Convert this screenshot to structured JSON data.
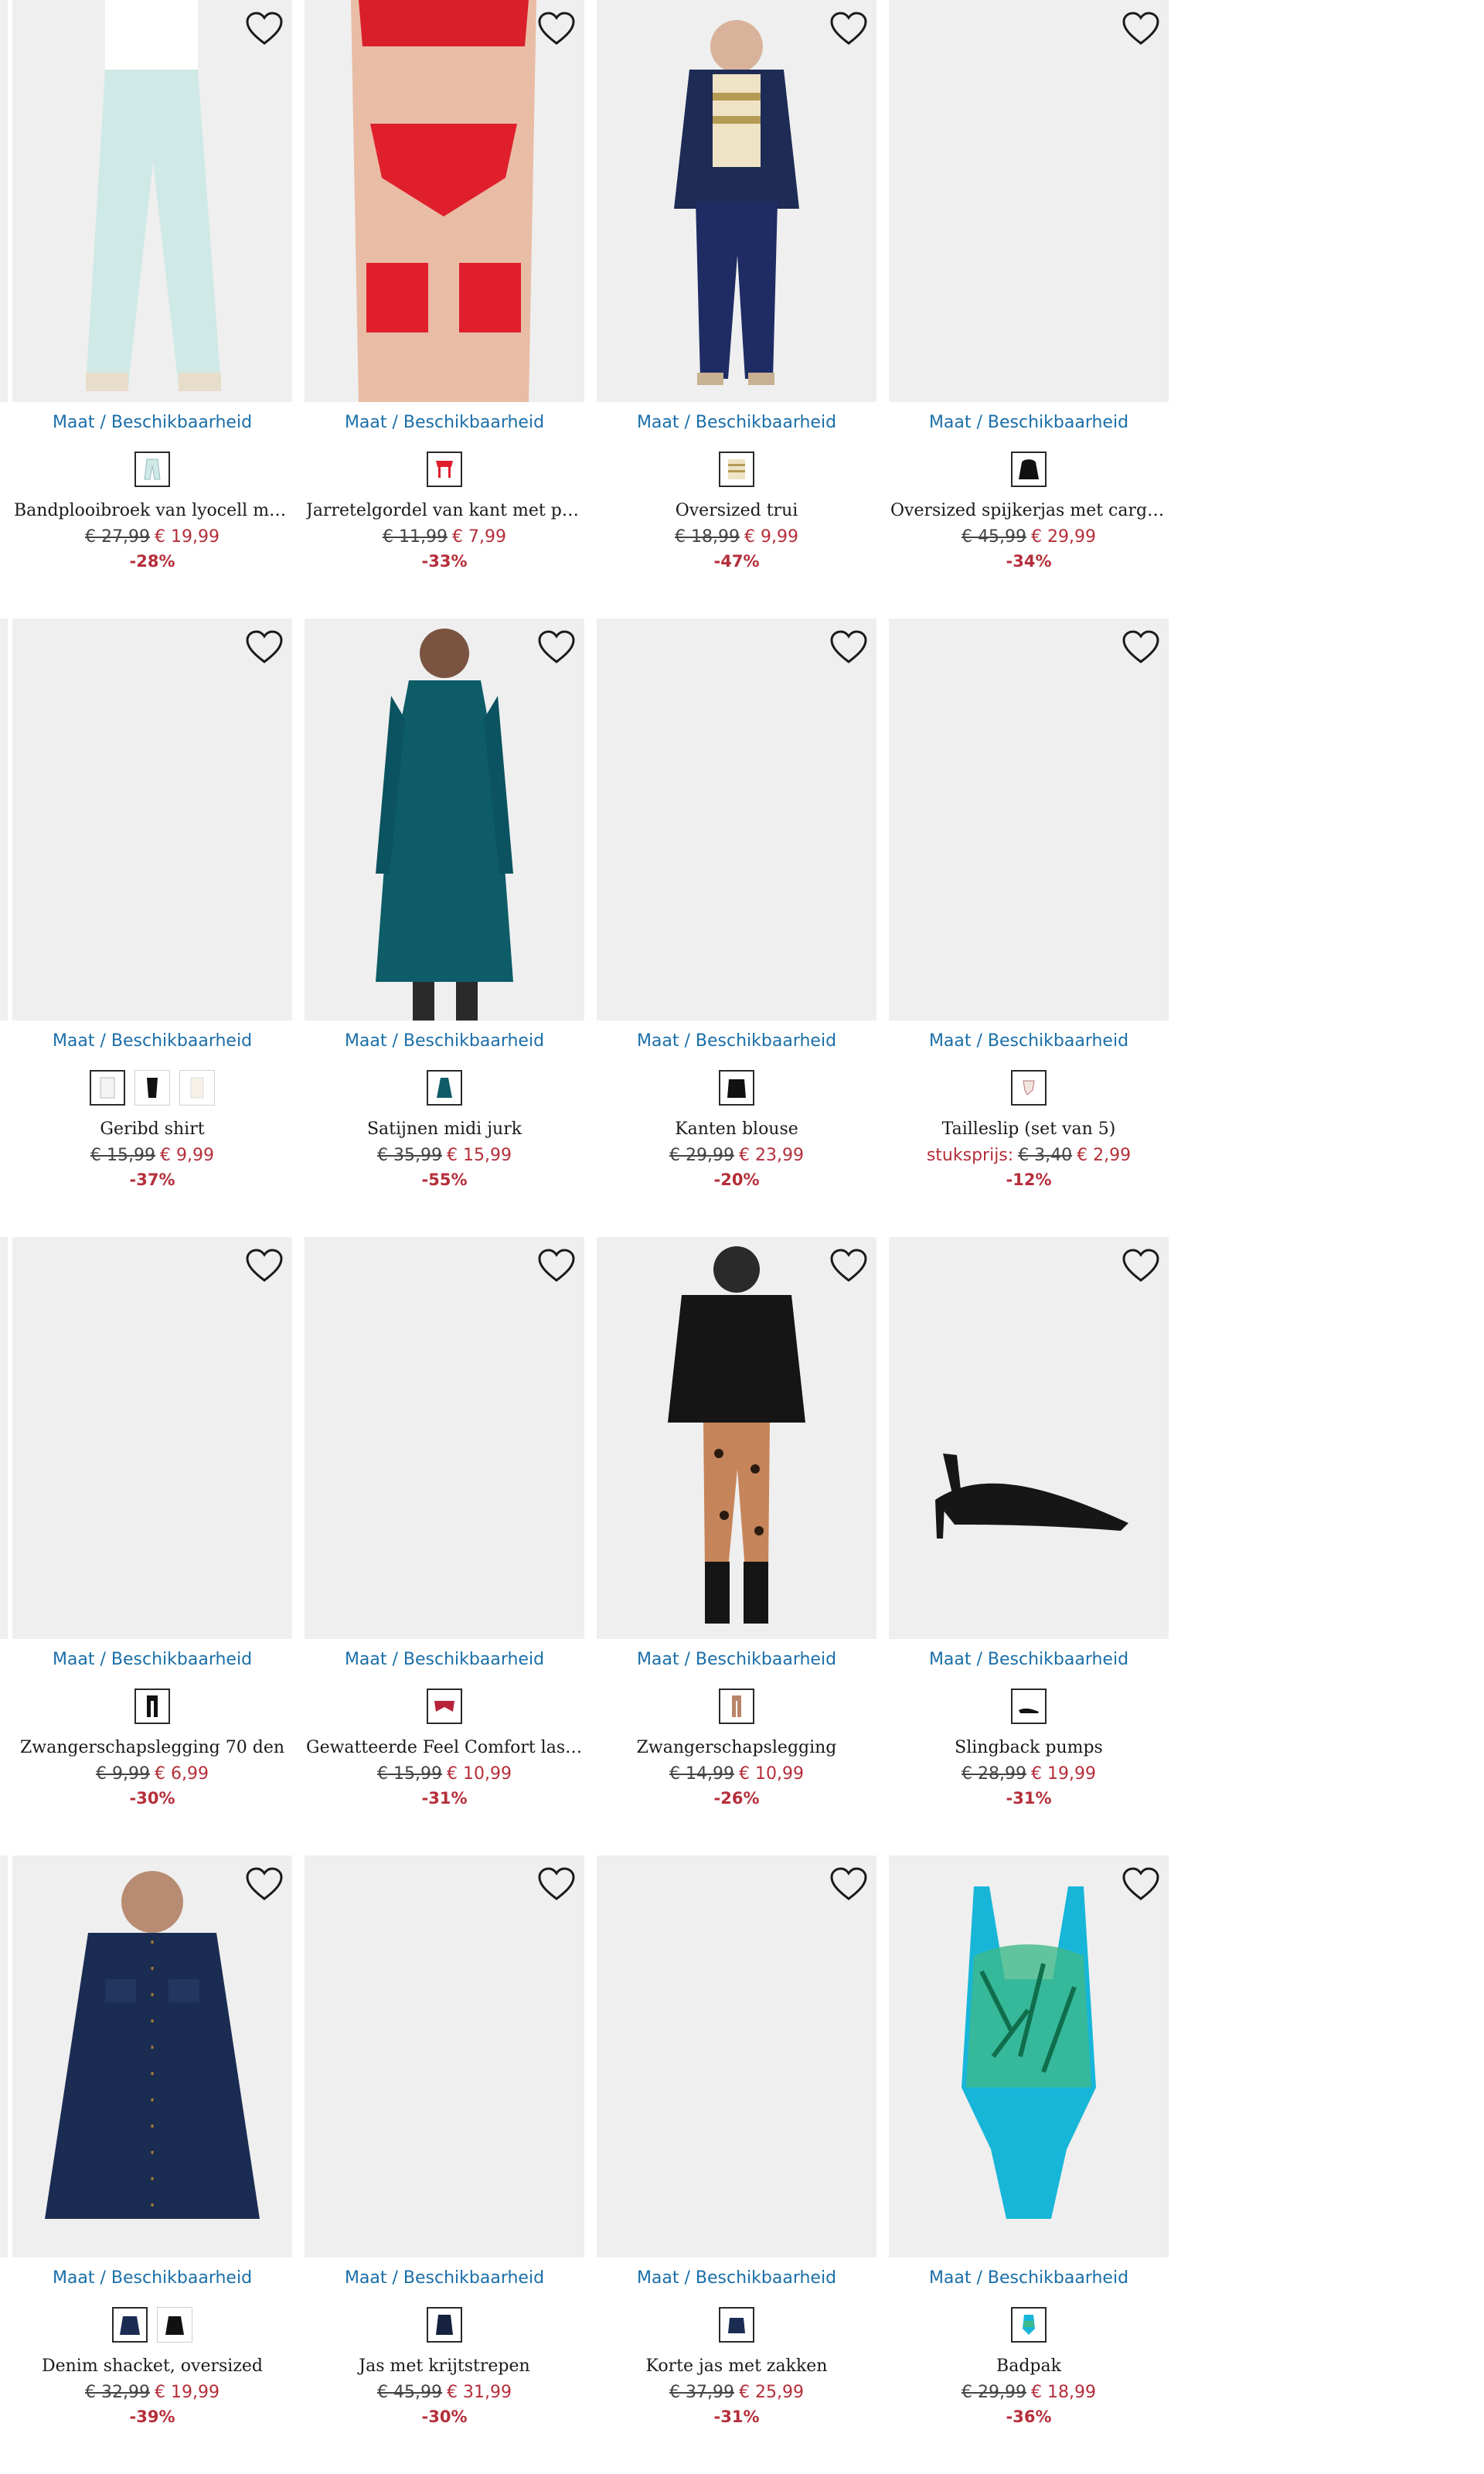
{
  "size_link_label": "Maat / Beschikbaarheid",
  "products": [
    {
      "name": "Bandplooibroek van lyocell met ko...",
      "old_price": "€ 27,99",
      "price": "€ 19,99",
      "discount": "-28%",
      "image": "light-blue-trousers",
      "swatches": [
        "light-blue-trousers-thumb"
      ]
    },
    {
      "name": "Jarretelgordel van kant met paillet...",
      "old_price": "€ 11,99",
      "price": "€ 7,99",
      "discount": "-33%",
      "image": "red-lace-garter-belt",
      "swatches": [
        "red-garter-thumb"
      ]
    },
    {
      "name": "Oversized trui",
      "old_price": "€ 18,99",
      "price": "€ 9,99",
      "discount": "-47%",
      "image": "striped-sweater-outfit",
      "swatches": [
        "striped-sweater-thumb"
      ]
    },
    {
      "name": "Oversized spijkerjas met cargodetails",
      "old_price": "€ 45,99",
      "price": "€ 29,99",
      "discount": "-34%",
      "image": "placeholder",
      "swatches": [
        "black-jacket-thumb"
      ]
    },
    {
      "name": "Geribd shirt",
      "old_price": "€ 15,99",
      "price": "€ 9,99",
      "discount": "-37%",
      "image": "placeholder",
      "swatches": [
        "white-shirt-thumb",
        "black-shirt-thumb",
        "ivory-shirt-thumb"
      ]
    },
    {
      "name": "Satijnen midi jurk",
      "old_price": "€ 35,99",
      "price": "€ 15,99",
      "discount": "-55%",
      "image": "teal-satin-dress",
      "swatches": [
        "teal-dress-thumb"
      ]
    },
    {
      "name": "Kanten blouse",
      "old_price": "€ 29,99",
      "price": "€ 23,99",
      "discount": "-20%",
      "image": "placeholder",
      "swatches": [
        "black-blouse-thumb"
      ]
    },
    {
      "name": "Tailleslip (set van 5)",
      "unit_label": "stuksprijs:",
      "old_price": "€ 3,40",
      "price": "€ 2,99",
      "discount": "-12%",
      "image": "placeholder",
      "swatches": [
        "brief-thumb"
      ]
    },
    {
      "name": "Zwangerschapslegging 70 den",
      "old_price": "€ 9,99",
      "price": "€ 6,99",
      "discount": "-30%",
      "image": "placeholder",
      "swatches": [
        "black-legging-thumb"
      ]
    },
    {
      "name": "Gewatteerde Feel Comfort lasercu...",
      "old_price": "€ 15,99",
      "price": "€ 10,99",
      "discount": "-31%",
      "image": "placeholder",
      "swatches": [
        "red-bra-thumb"
      ]
    },
    {
      "name": "Zwangerschapslegging",
      "old_price": "€ 14,99",
      "price": "€ 10,99",
      "discount": "-26%",
      "image": "leopard-legging-outfit",
      "swatches": [
        "brown-legging-thumb"
      ]
    },
    {
      "name": "Slingback pumps",
      "old_price": "€ 28,99",
      "price": "€ 19,99",
      "discount": "-31%",
      "image": "black-slingback-pump",
      "swatches": [
        "pump-thumb"
      ]
    },
    {
      "name": "Denim shacket, oversized",
      "old_price": "€ 32,99",
      "price": "€ 19,99",
      "discount": "-39%",
      "image": "denim-shacket",
      "swatches": [
        "navy-jacket-thumb",
        "black-jacket-thumb-2"
      ]
    },
    {
      "name": "Jas met krijtstrepen",
      "old_price": "€ 45,99",
      "price": "€ 31,99",
      "discount": "-30%",
      "image": "placeholder",
      "swatches": [
        "navy-coat-thumb"
      ]
    },
    {
      "name": "Korte jas met zakken",
      "old_price": "€ 37,99",
      "price": "€ 25,99",
      "discount": "-31%",
      "image": "placeholder",
      "swatches": [
        "navy-short-jacket-thumb"
      ]
    },
    {
      "name": "Badpak",
      "old_price": "€ 29,99",
      "price": "€ 18,99",
      "discount": "-36%",
      "image": "tropical-swimsuit",
      "swatches": [
        "swimsuit-thumb"
      ]
    }
  ],
  "colors": {
    "link": "#1a6ea8",
    "sale": "#b52e3a",
    "image_bg": "#efefef",
    "text": "#1a1a1a"
  }
}
